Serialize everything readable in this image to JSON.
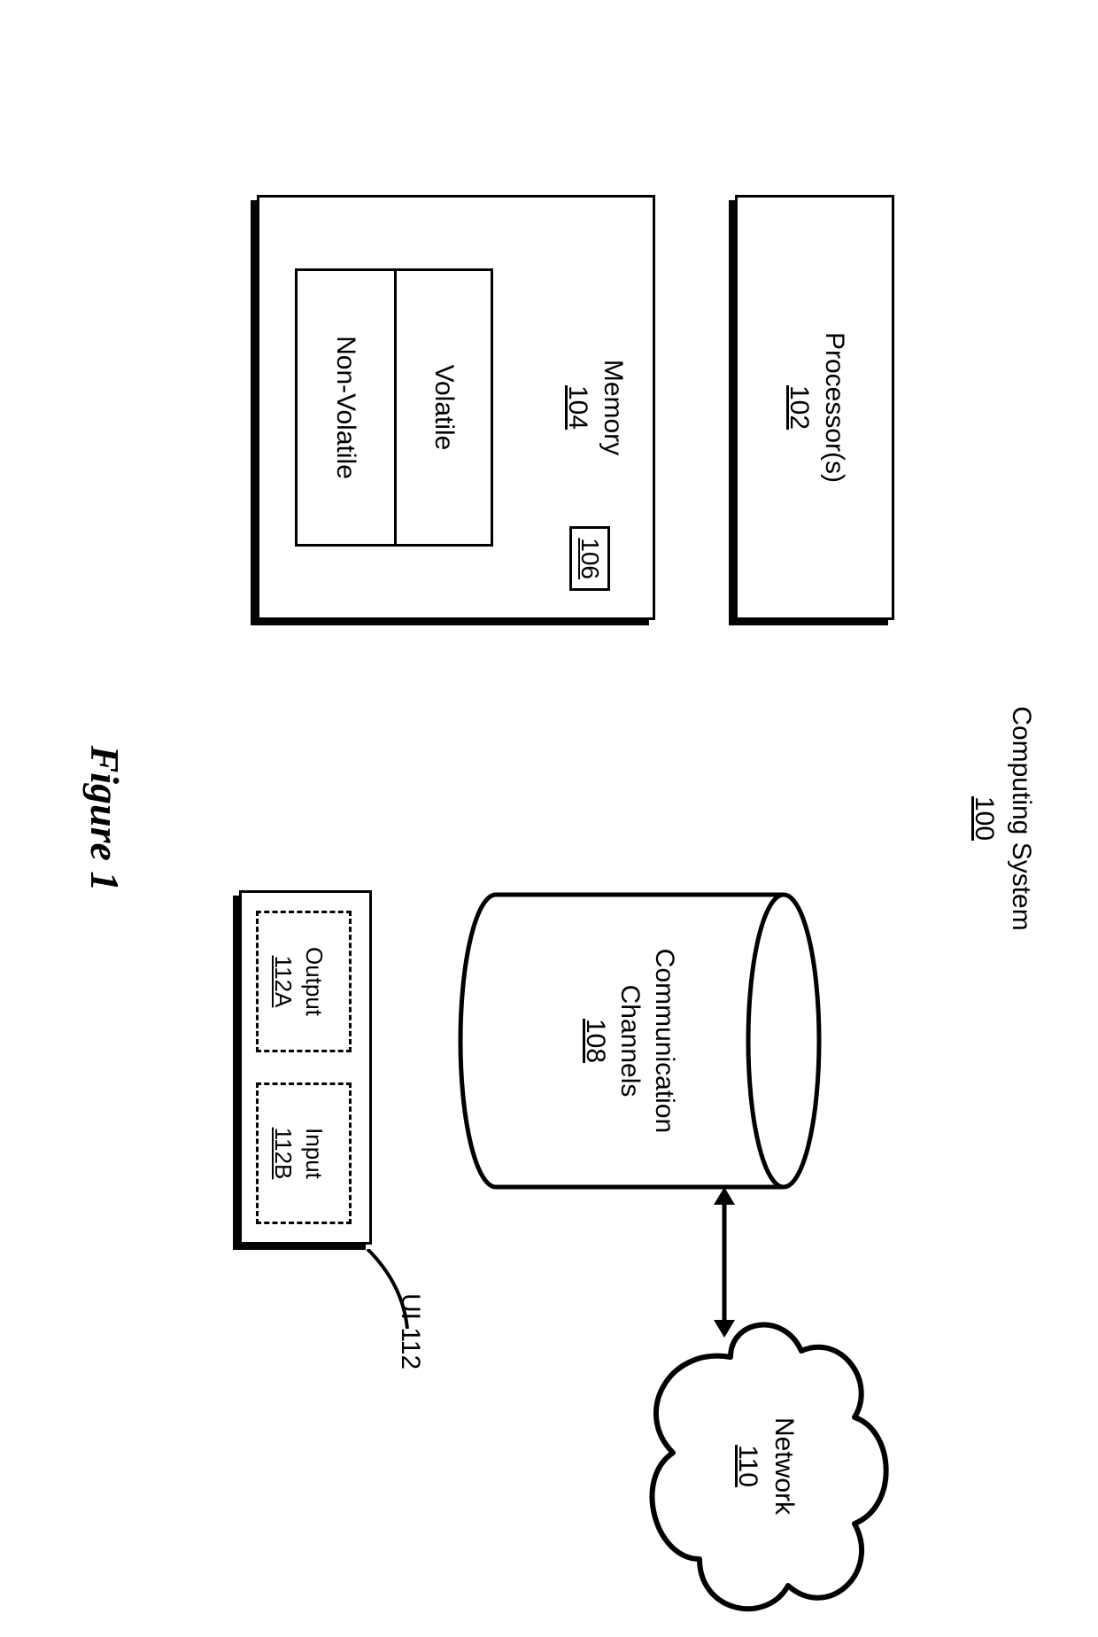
{
  "figure_caption": "Figure 1",
  "title": {
    "label": "Computing System",
    "ref": "100"
  },
  "processor": {
    "label": "Processor(s)",
    "ref": "102"
  },
  "memory": {
    "label": "Memory",
    "ref": "104",
    "exe_ref": "106",
    "volatile_label": "Volatile",
    "nonvolatile_label": "Non-Volatile"
  },
  "comm": {
    "label_line1": "Communication",
    "label_line2": "Channels",
    "ref": "108"
  },
  "network": {
    "label": "Network",
    "ref": "110"
  },
  "ui": {
    "leader_label": "UI 112",
    "output": {
      "label": "Output",
      "ref": "112A"
    },
    "input": {
      "label": "Input",
      "ref": "112B"
    }
  }
}
